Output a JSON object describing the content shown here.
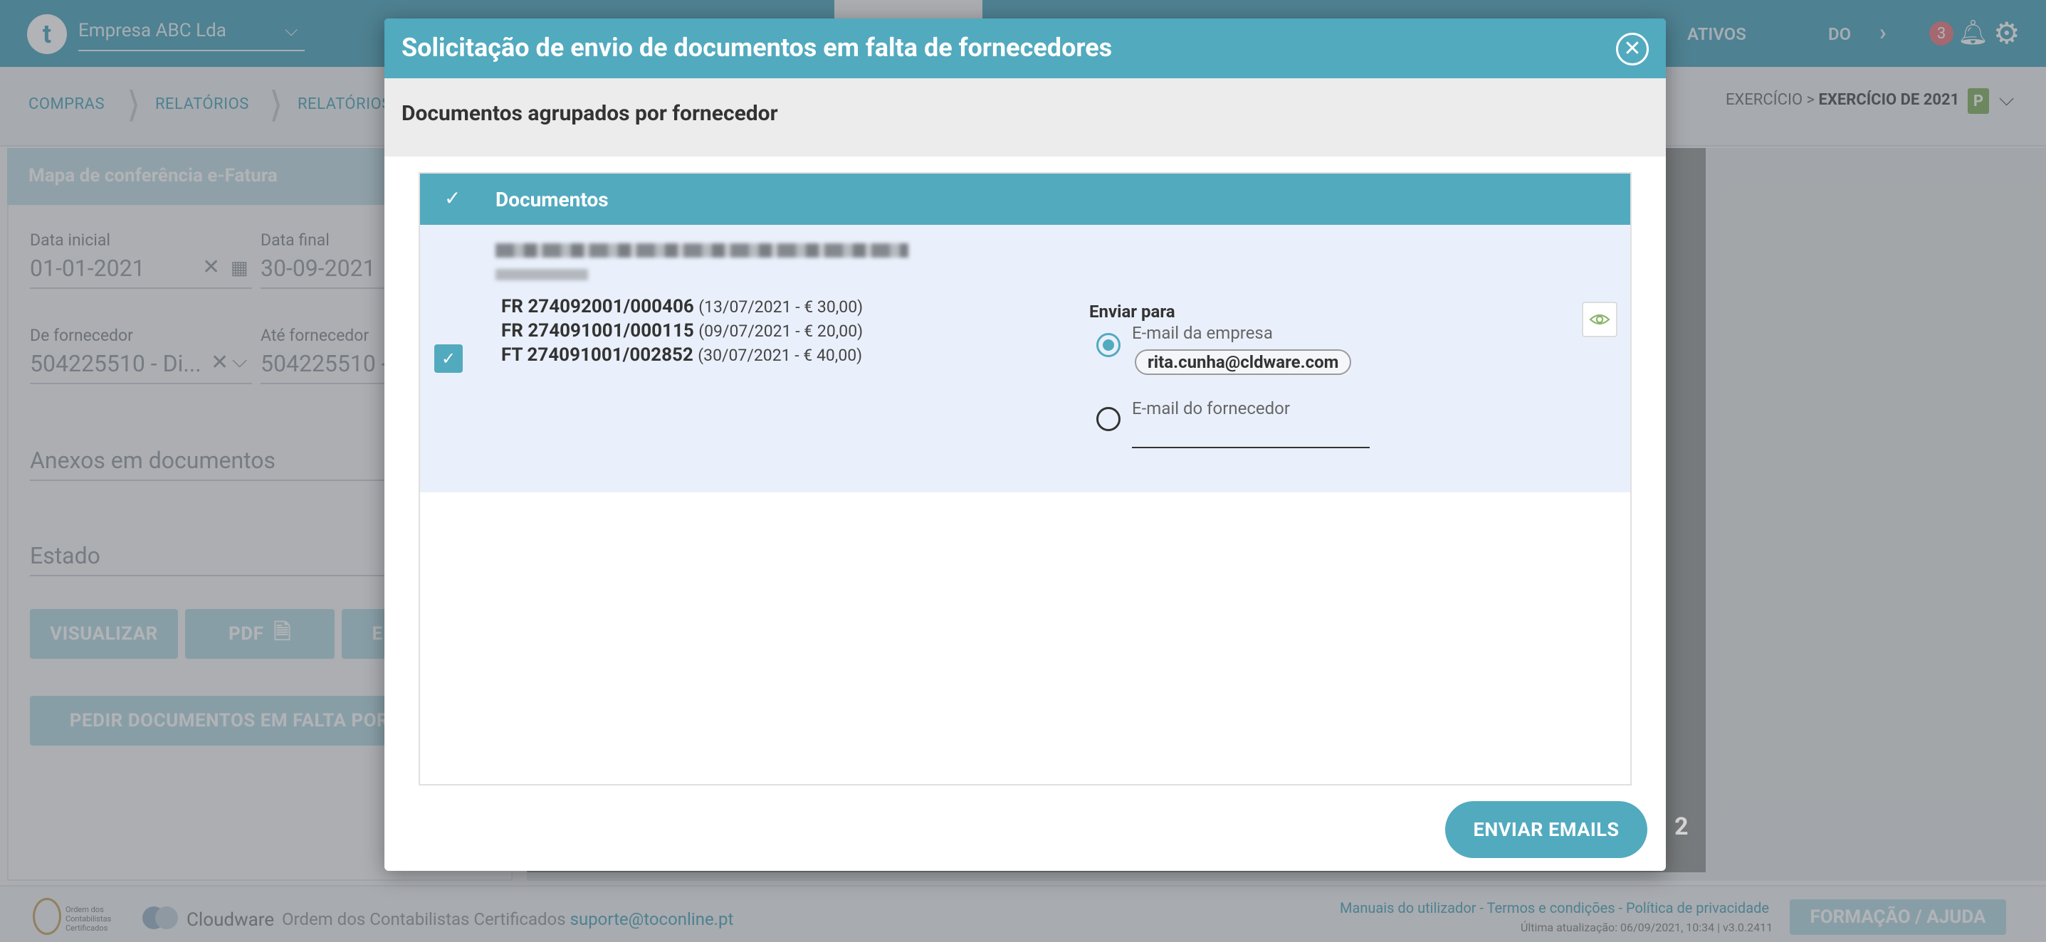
{
  "app": {
    "company": "Empresa ABC Lda",
    "top_right": {
      "ativos": "ATIVOS",
      "do": "DO",
      "notifications": "3"
    }
  },
  "breadcrumb": {
    "items": [
      "COMPRAS",
      "RELATÓRIOS",
      "RELATÓRIOS"
    ],
    "exercise_prefix": "EXERCÍCIO > ",
    "exercise_value": "EXERCÍCIO DE 2021",
    "exercise_badge": "P"
  },
  "panel": {
    "title": "Mapa de conferência e-Fatura",
    "start_label": "Data inicial",
    "start_value": "01-01-2021",
    "end_label": "Data final",
    "end_value": "30-09-2021",
    "from_label": "De fornecedor",
    "from_value": "504225510 - Di...",
    "to_label": "Até fornecedor",
    "to_value": "504225510 -",
    "attachments_placeholder": "Anexos em documentos",
    "state_placeholder": "Estado",
    "btn_view": "VISUALIZAR",
    "btn_pdf": "PDF",
    "btn_export": "E",
    "btn_request": "PEDIR DOCUMENTOS EM FALTA POR"
  },
  "page_number": "2",
  "modal": {
    "title": "Solicitação de envio de documentos em falta de fornecedores",
    "subtitle": "Documentos agrupados por fornecedor",
    "table_header": "Documentos",
    "documents": [
      {
        "number": "FR 274092001/000406",
        "detail": "(13/07/2021 - € 30,00)"
      },
      {
        "number": "FR 274091001/000115",
        "detail": "(09/07/2021 - € 20,00)"
      },
      {
        "number": "FT 274091001/002852",
        "detail": "(30/07/2021 - € 40,00)"
      }
    ],
    "send_to_label": "Enviar para",
    "option_company": "E-mail da empresa",
    "company_email": "rita.cunha@cldware.com",
    "option_supplier": "E-mail do fornecedor",
    "send_button": "ENVIAR EMAILS"
  },
  "footer": {
    "occ_small": "Ordem dos Contabilistas Certificados",
    "cloudware": "Cloudware",
    "occ_text": "Ordem dos Contabilistas Certificados",
    "support_email": "suporte@toconline.pt",
    "links": "Manuais do utilizador - Termos e condições - Política de privacidade",
    "last_update": "Última atualização: 06/09/2021, 10:34 | v3.0.2411",
    "help_button": "FORMAÇÃO / AJUDA"
  }
}
